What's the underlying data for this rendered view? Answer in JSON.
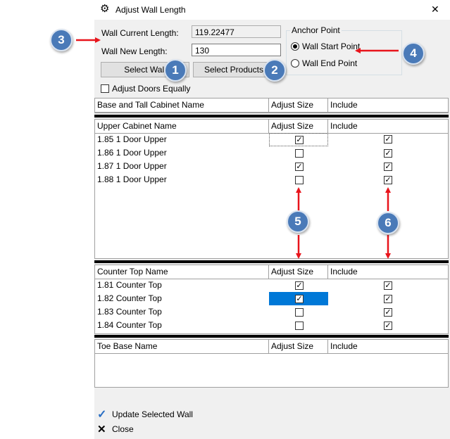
{
  "window": {
    "title": "Adjust Wall Length"
  },
  "form": {
    "current_label": "Wall Current Length:",
    "current_value": "119.22477",
    "new_label": "Wall New Length:",
    "new_value": "130",
    "select_wall": "Select Wall",
    "select_products": "Select Products",
    "adjust_doors": "Adjust Doors Equally"
  },
  "anchor": {
    "title": "Anchor Point",
    "options": [
      "Wall Start Point",
      "Wall End Point"
    ],
    "selected": "Wall Start Point"
  },
  "grids": {
    "base": {
      "headers": [
        "Base and Tall Cabinet Name",
        "Adjust Size",
        "Include"
      ],
      "rows": []
    },
    "upper": {
      "headers": [
        "Upper Cabinet Name",
        "Adjust Size",
        "Include"
      ],
      "rows": [
        {
          "name": "1.85 1 Door Upper",
          "adjust": true,
          "include": true
        },
        {
          "name": "1.86 1 Door Upper",
          "adjust": false,
          "include": true
        },
        {
          "name": "1.87 1 Door Upper",
          "adjust": true,
          "include": true
        },
        {
          "name": "1.88 1 Door Upper",
          "adjust": false,
          "include": true
        }
      ]
    },
    "counter": {
      "headers": [
        "Counter Top Name",
        "Adjust Size",
        "Include"
      ],
      "rows": [
        {
          "name": "1.81 Counter Top",
          "adjust": true,
          "include": true
        },
        {
          "name": "1.82 Counter Top",
          "adjust": true,
          "include": true
        },
        {
          "name": "1.83 Counter Top",
          "adjust": false,
          "include": true
        },
        {
          "name": "1.84 Counter Top",
          "adjust": false,
          "include": true
        }
      ]
    },
    "toe": {
      "headers": [
        "Toe Base Name",
        "Adjust Size",
        "Include"
      ],
      "rows": []
    }
  },
  "actions": {
    "update": "Update Selected Wall",
    "close": "Close"
  },
  "callouts": [
    "1",
    "2",
    "3",
    "4",
    "5",
    "6"
  ],
  "colors": {
    "callout": "#4a7ab8",
    "arrow": "#e8141b",
    "selection": "#0078d7"
  }
}
